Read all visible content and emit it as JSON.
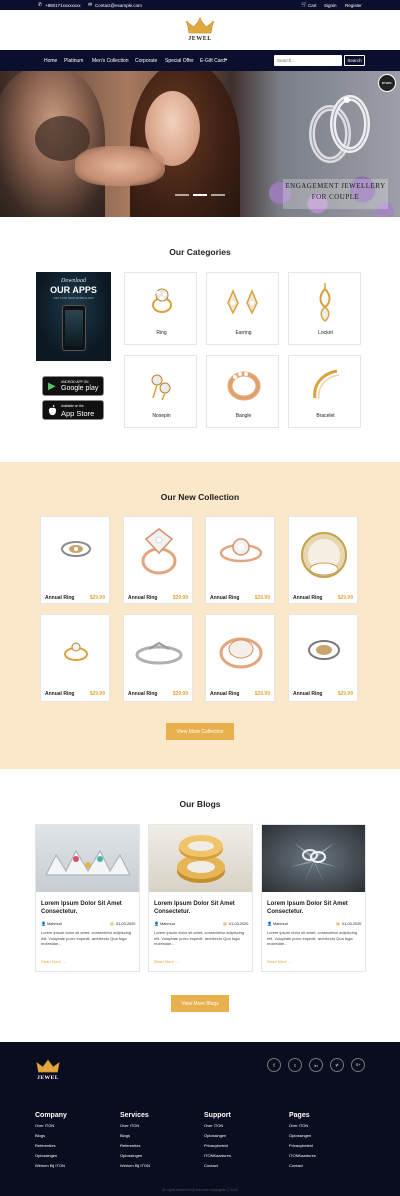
{
  "topbar": {
    "phone": "+880171xxxxxxxx",
    "email": "Contact@example.com",
    "cart": "Cart",
    "signin": "Signin",
    "register": "Register"
  },
  "logo": {
    "text": "JEWEL"
  },
  "nav": {
    "items": [
      "Home",
      "Platinum",
      "Men's Collection",
      "Corporate",
      "Special Offer",
      "E-Gift Card"
    ],
    "search_placeholder": "Search...",
    "search_button": "Search"
  },
  "hero": {
    "caption_line1": "ENGAGEMENT JEWELLERY",
    "caption_line2": "FOR COUPLE",
    "brand_badge": "JEWEL"
  },
  "categories": {
    "title": "Our Categories",
    "app_promo": {
      "line1": "Download",
      "line2": "OUR APPS",
      "line3": "GET OUR NEW MOBILE APP"
    },
    "google_play": {
      "small": "ANDROID APP ON",
      "big": "Google play"
    },
    "app_store": {
      "small": "Available on the",
      "big": "App Store"
    },
    "items": [
      "Ring",
      "Earring",
      "Locket",
      "Nosepin",
      "Bangle",
      "Bracelet"
    ]
  },
  "collection": {
    "title": "Our New Collection",
    "items": [
      {
        "name": "Annual Ring",
        "price": "$29.99"
      },
      {
        "name": "Annual Ring",
        "price": "$29.99"
      },
      {
        "name": "Annual Ring",
        "price": "$29.99"
      },
      {
        "name": "Annual Ring",
        "price": "$29.99"
      },
      {
        "name": "Annual Ring",
        "price": "$29.99"
      },
      {
        "name": "Annual Ring",
        "price": "$29.99"
      },
      {
        "name": "Annual Ring",
        "price": "$29.99"
      },
      {
        "name": "Annual Ring",
        "price": "$29.99"
      }
    ],
    "button": "View More Collection"
  },
  "blogs": {
    "title": "Our Blogs",
    "items": [
      {
        "title": "Lorem Ipsum Dolor Sit Amet Consectetur.",
        "author": "Mahmud",
        "date": "01-03-2020",
        "excerpt": "Lorem ipsum dolor sit amet, consectetur adipiscing elit. Voluptate porro impedit, architecto Qua fuga molestiae...",
        "read_more": "Read More →"
      },
      {
        "title": "Lorem Ipsum Dolor Sit Amet Consectetur.",
        "author": "Mahmud",
        "date": "01-03-2020",
        "excerpt": "Lorem ipsum dolor sit amet, consectetur adipiscing elit. Voluptate porro impedit, architecto Qua fuga molestiae...",
        "read_more": "Read More →"
      },
      {
        "title": "Lorem Ipsum Dolor Sit Amet Consectetur.",
        "author": "Mahmud",
        "date": "01-03-2020",
        "excerpt": "Lorem ipsum dolor sit amet, consectetur adipiscing elit. Voluptate porro impedit, architecto Qua fuga molestiae...",
        "read_more": "Read More →"
      }
    ],
    "button": "View More Blogs"
  },
  "footer": {
    "logo_text": "JEWEL",
    "social": [
      "f",
      "t",
      "in",
      "yt",
      "G+"
    ],
    "columns": [
      {
        "title": "Company",
        "links": [
          "Over ITON",
          "Blogs",
          "Referenties",
          "Oplossingen",
          "Werken Bij ITON"
        ]
      },
      {
        "title": "Services",
        "links": [
          "Over ITON",
          "Blogs",
          "Referenties",
          "Oplossingen",
          "Werken Bij ITON"
        ]
      },
      {
        "title": "Support",
        "links": [
          "Over ITON",
          "Oplossingen",
          "Privacybeleid",
          "ITONKaartures",
          "Contact"
        ]
      },
      {
        "title": "Pages",
        "links": [
          "Over ITON",
          "Oplossingen",
          "Privacybeleid",
          "ITONKaartures",
          "Contact"
        ]
      }
    ],
    "copyright": "All rights reserved by ivan-info copyrights © 2020"
  },
  "colors": {
    "navy": "#0b0e2c",
    "gold": "#e9b04e",
    "cream": "#fbe7c9"
  }
}
